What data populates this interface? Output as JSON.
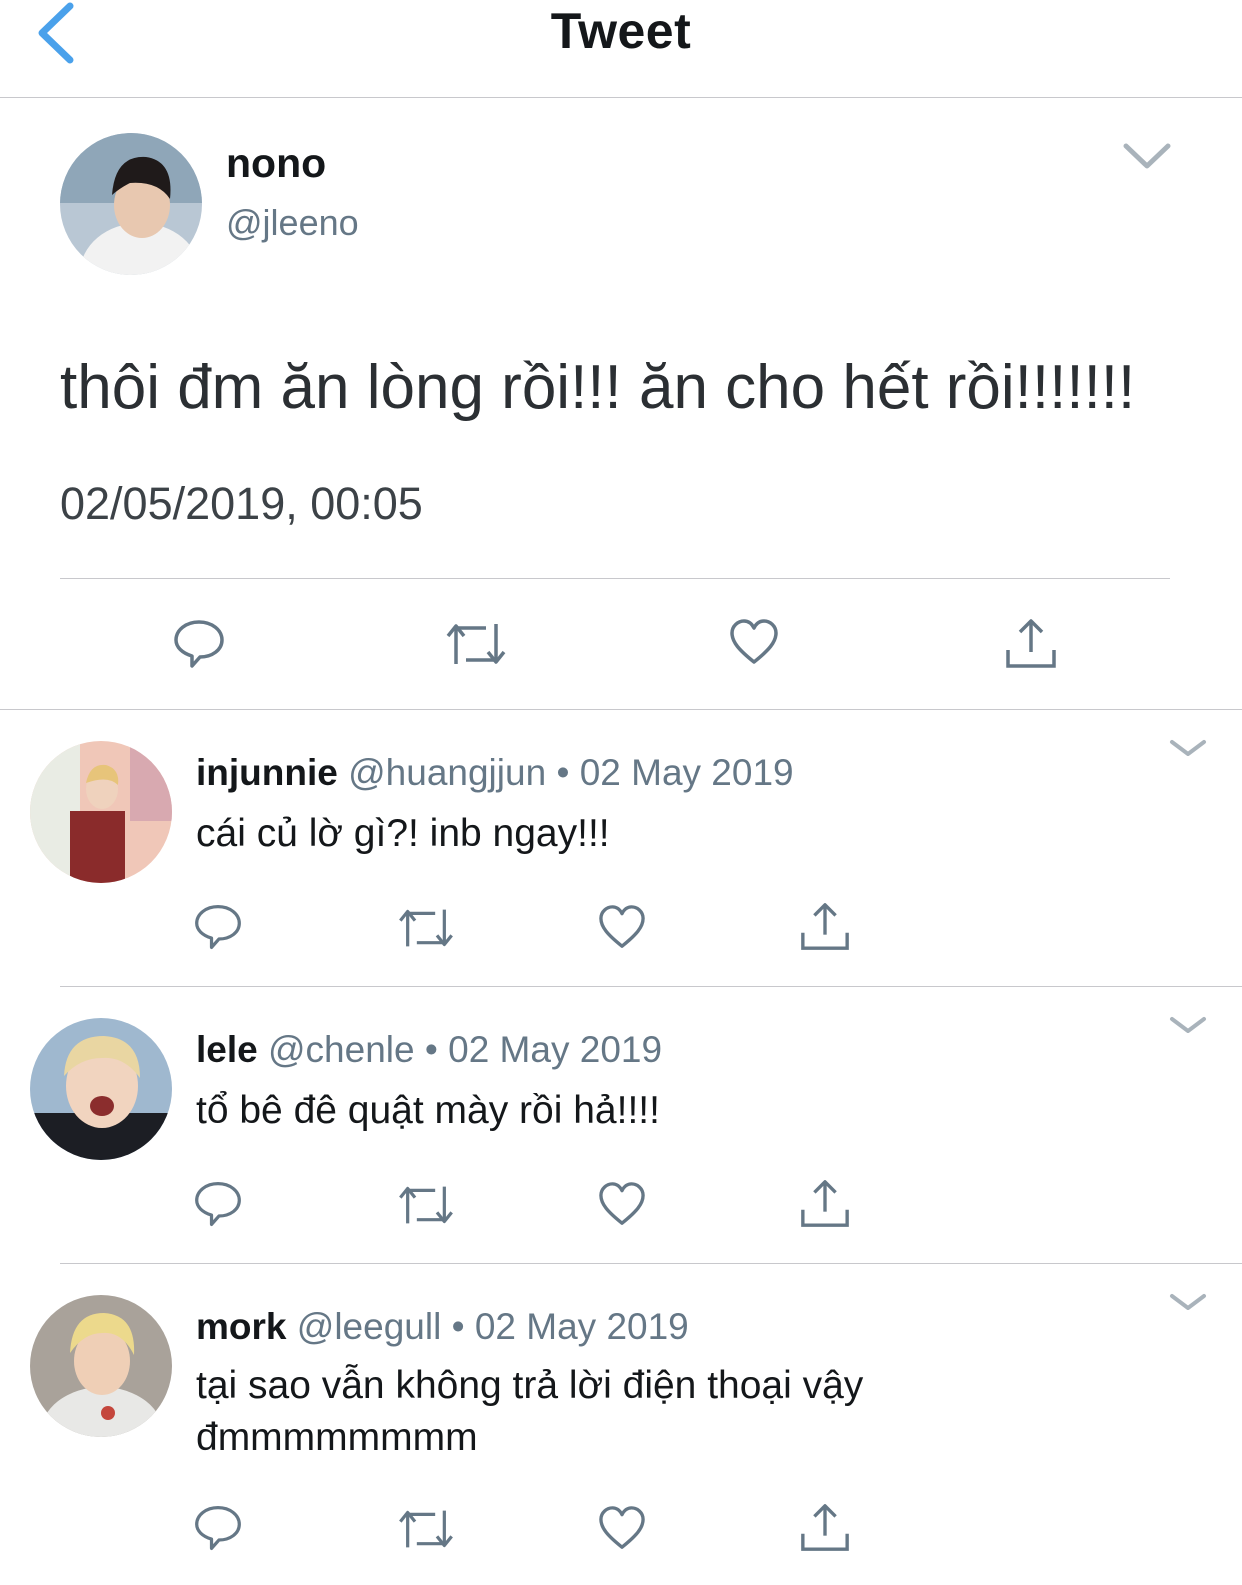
{
  "header": {
    "title": "Tweet"
  },
  "main_tweet": {
    "display_name": "nono",
    "handle": "@jleeno",
    "text": "thôi đm ăn lòng rồi!!! ăn cho hết rồi!!!!!!!",
    "timestamp": "02/05/2019, 00:05"
  },
  "replies": [
    {
      "display_name": "injunnie",
      "handle": "@huangjjun",
      "separator": "•",
      "date": "02 May 2019",
      "text_lines": [
        "cái củ lờ gì?! inb ngay!!!"
      ]
    },
    {
      "display_name": "lele",
      "handle": "@chenle",
      "separator": "•",
      "date": "02 May 2019",
      "text_lines": [
        "tổ bê đê quật mày rồi hả!!!!"
      ]
    },
    {
      "display_name": "mork",
      "handle": "@leegull",
      "separator": "•",
      "date": "02 May 2019",
      "text_lines": [
        "tại sao vẫn không trả lời điện thoại vậy",
        "đmmmmmmmm"
      ]
    }
  ],
  "icons": {
    "back": "chevron-left-icon",
    "more": "chevron-down-icon",
    "reply": "reply-icon",
    "retweet": "retweet-icon",
    "like": "heart-icon",
    "share": "share-icon"
  },
  "colors": {
    "accent": "#4aa1eb",
    "icon": "#657786",
    "divider": "#c8c8cc",
    "secondary_text": "#657786"
  }
}
